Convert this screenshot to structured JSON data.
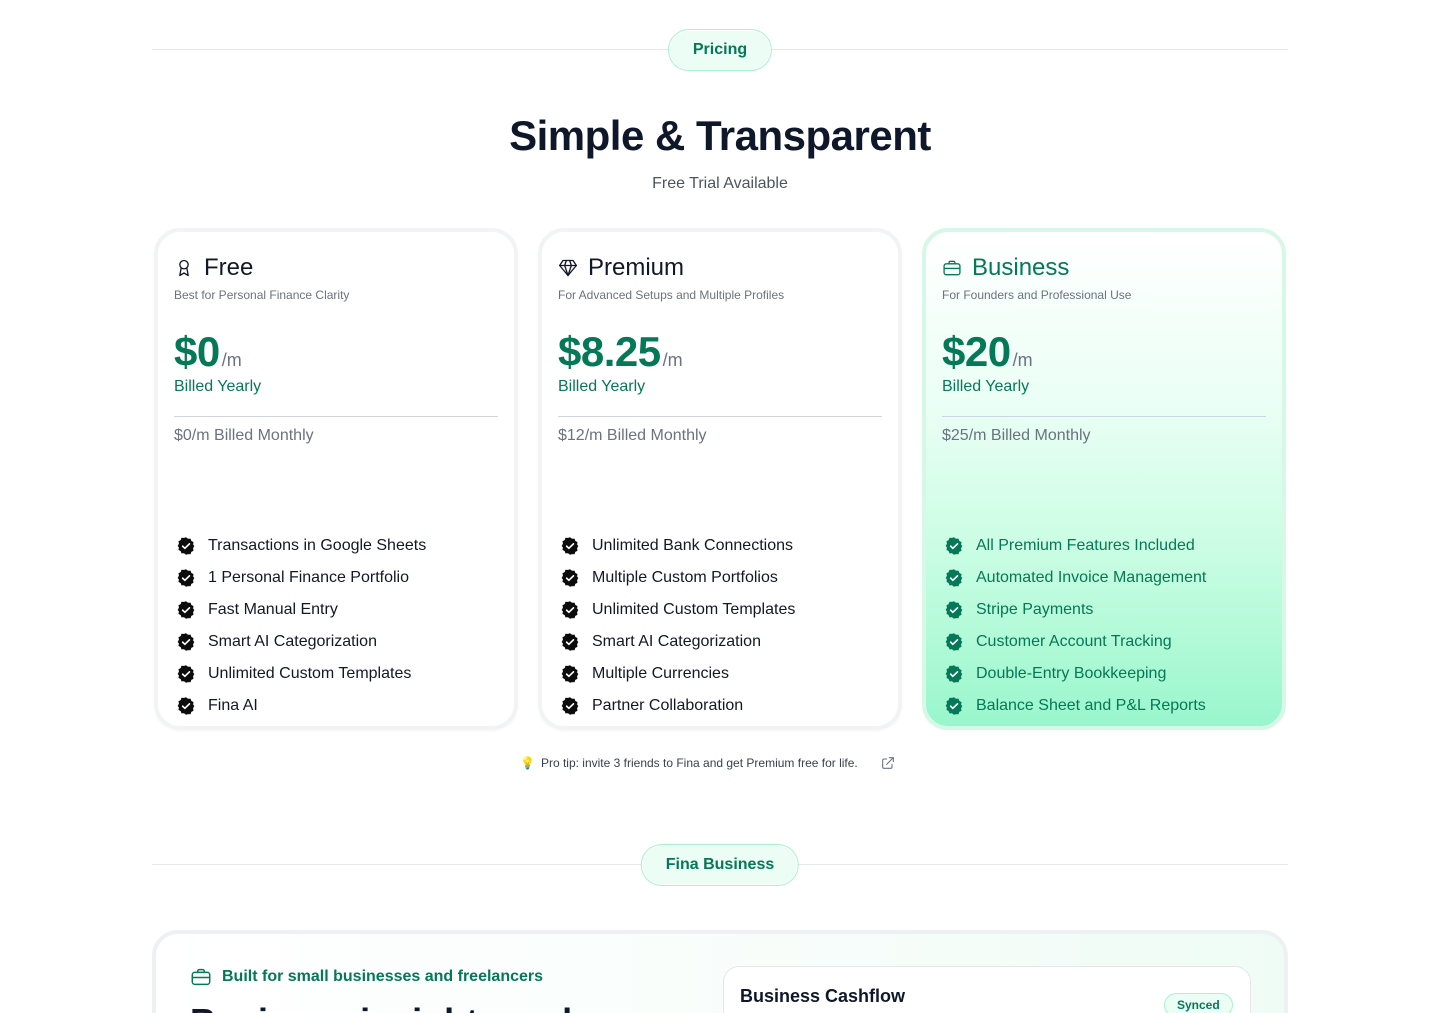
{
  "pricing_section": {
    "pill_label": "Pricing",
    "title": "Simple & Transparent",
    "subtitle": "Free Trial Available"
  },
  "plans": [
    {
      "name": "Free",
      "icon": "award-icon",
      "description": "Best for Personal Finance Clarity",
      "price": "$0",
      "per": "/m",
      "billed": "Billed Yearly",
      "monthly": "$0/m Billed Monthly",
      "features": [
        "Transactions in Google Sheets",
        "1 Personal Finance Portfolio",
        "Fast Manual Entry",
        "Smart AI Categorization",
        "Unlimited Custom Templates",
        "Fina AI"
      ]
    },
    {
      "name": "Premium",
      "icon": "diamond-icon",
      "description": "For Advanced Setups and Multiple Profiles",
      "price": "$8.25",
      "per": "/m",
      "billed": "Billed Yearly",
      "monthly": "$12/m Billed Monthly",
      "features": [
        "Unlimited Bank Connections",
        "Multiple Custom Portfolios",
        "Unlimited Custom Templates",
        "Smart AI Categorization",
        "Multiple Currencies",
        "Partner Collaboration"
      ]
    },
    {
      "name": "Business",
      "icon": "briefcase-icon",
      "description": "For Founders and Professional Use",
      "price": "$20",
      "per": "/m",
      "billed": "Billed Yearly",
      "monthly": "$25/m Billed Monthly",
      "features": [
        "All Premium Features Included",
        "Automated Invoice Management",
        "Stripe Payments",
        "Customer Account Tracking",
        "Double-Entry Bookkeeping",
        "Balance Sheet and P&L Reports"
      ]
    }
  ],
  "protip": {
    "emoji": "💡",
    "text": "Pro tip: invite 3 friends to Fina and get Premium free for life."
  },
  "business_section": {
    "pill_label": "Fina Business",
    "tagline": "Built for small businesses and freelancers",
    "heading_partial": "Business insights and",
    "cashflow_title": "Business Cashflow",
    "synced_badge": "Synced"
  },
  "colors": {
    "accent": "#047857",
    "pill_bg": "#ecfdf5",
    "business_gradient_end": "#99f6cc"
  }
}
